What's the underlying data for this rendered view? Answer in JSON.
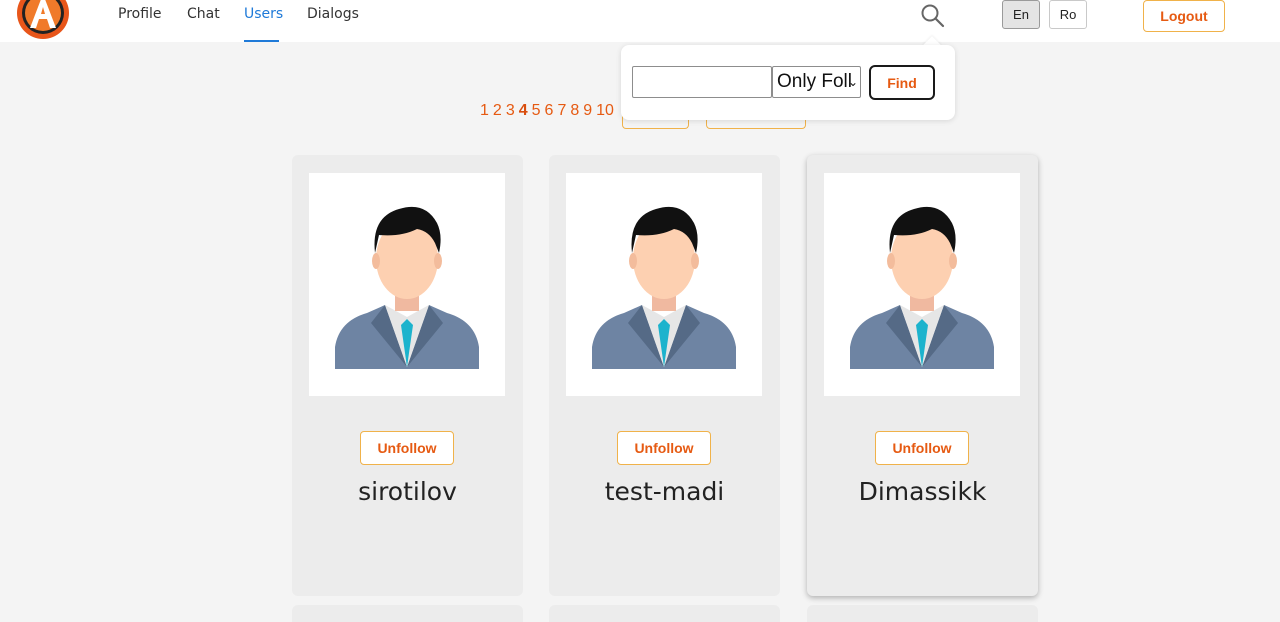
{
  "header": {
    "nav": [
      "Profile",
      "Chat",
      "Users",
      "Dialogs"
    ],
    "active_nav": "Users",
    "languages": [
      "En",
      "Ro"
    ],
    "active_language": "En",
    "logout_label": "Logout"
  },
  "search_popup": {
    "input_value": "",
    "filter_selected": "Only Foll",
    "find_label": "Find"
  },
  "pagination": {
    "pages": [
      "1",
      "2",
      "3",
      "4",
      "5",
      "6",
      "7",
      "8",
      "9",
      "10"
    ],
    "current": "4"
  },
  "users": [
    {
      "name": "sirotilov",
      "action_label": "Unfollow"
    },
    {
      "name": "test-madi",
      "action_label": "Unfollow"
    },
    {
      "name": "Dimassikk",
      "action_label": "Unfollow"
    }
  ],
  "colors": {
    "accent": "#e65a12",
    "accent_border": "#f0b24a",
    "active_nav": "#1f7ad8",
    "background": "#f4f4f4"
  },
  "icons": [
    "logo-icon",
    "search-icon",
    "avatar-icon",
    "chevron-down-icon"
  ]
}
